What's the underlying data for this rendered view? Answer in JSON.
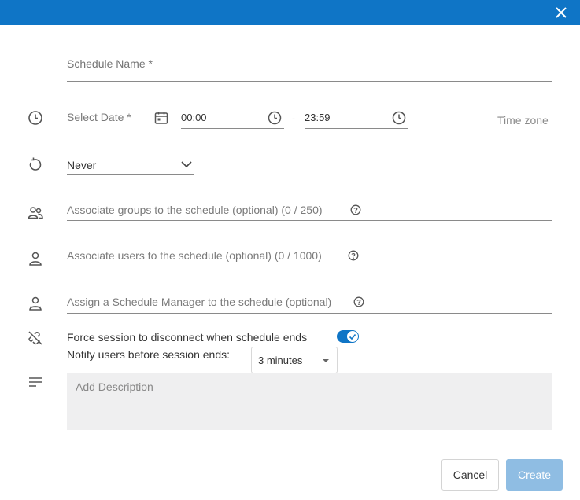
{
  "dialog": {
    "title_bar_color": "#0f75c6",
    "close_icon": "close-icon"
  },
  "form": {
    "schedule_name": {
      "placeholder": "Schedule Name *",
      "value": ""
    },
    "date": {
      "placeholder": "Select Date *",
      "icon": "calendar-icon"
    },
    "start_time": {
      "value": "00:00",
      "icon": "clock-icon"
    },
    "separator": "-",
    "end_time": {
      "value": "23:59",
      "icon": "clock-icon"
    },
    "timezone_label": "Time zone",
    "recurrence": {
      "value": "Never",
      "icon": "chevron-down-icon"
    },
    "groups": {
      "placeholder": "Associate groups to the schedule (optional)  (0 / 250)"
    },
    "users": {
      "placeholder": "Associate users to the schedule (optional)  (0 / 1000)"
    },
    "manager": {
      "placeholder": "Assign a Schedule Manager to the schedule (optional)"
    },
    "force_disconnect": {
      "label": "Force session to disconnect when schedule ends",
      "enabled": true
    },
    "notify": {
      "label": "Notify users before session ends:",
      "value": "3 minutes"
    },
    "description": {
      "placeholder": "Add Description"
    }
  },
  "buttons": {
    "cancel": "Cancel",
    "create": "Create"
  },
  "colors": {
    "accent": "#0f75c6",
    "create_disabled": "#8fbde3",
    "description_bg": "#efeff0"
  }
}
